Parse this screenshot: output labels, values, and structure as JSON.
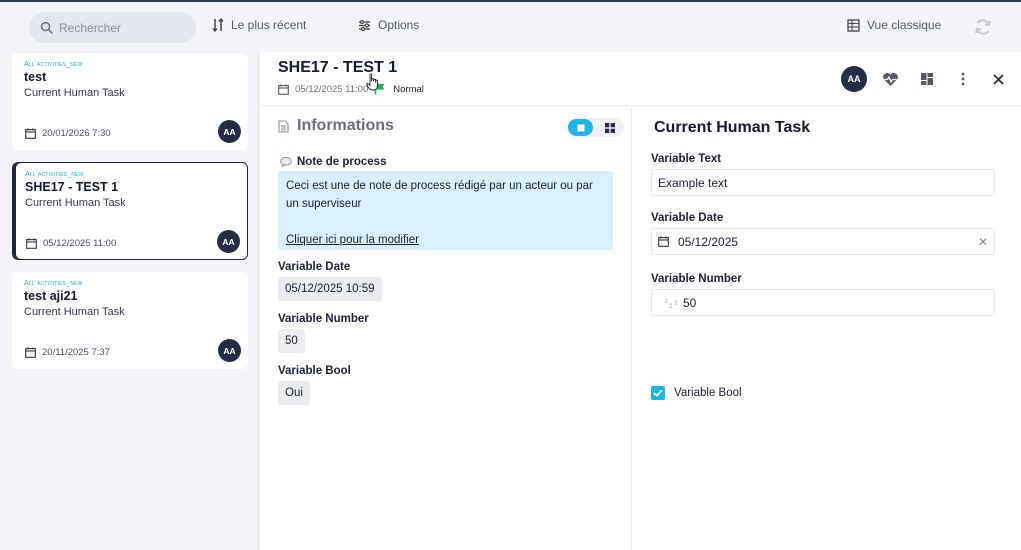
{
  "colors": {
    "accent": "#1fb5e8",
    "dark": "#262b46",
    "flag": "#22b14c",
    "note_bg": "#d7f0fb"
  },
  "toolbar": {
    "search_placeholder": "Rechercher",
    "recent_label": "Le plus récent",
    "options_label": "Options",
    "classic_label": "Vue classique"
  },
  "sidebar": {
    "cards": [
      {
        "category": "All activities_new",
        "title": "test",
        "subtitle": "Current Human Task",
        "date": "20/01/2026 7:30",
        "avatar": "AA",
        "selected": false
      },
      {
        "category": "All activities_new",
        "title": "SHE17 - TEST 1",
        "subtitle": "Current Human Task",
        "date": "05/12/2025 11:00",
        "avatar": "AA",
        "selected": true
      },
      {
        "category": "All activities_new",
        "title": "test aji21",
        "subtitle": "Current Human Task",
        "date": "20/11/2025 7:37",
        "avatar": "AA",
        "selected": false
      }
    ]
  },
  "task": {
    "title": "SHE17 - TEST 1",
    "date": "05/12/2025 11:00",
    "priority": "Normal",
    "avatar": "AA"
  },
  "info": {
    "title": "Informations",
    "note_label": "Note de process",
    "note_text": "Ceci est une de note de process rédigé par un acteur ou par un superviseur",
    "note_link": "Cliquer ici pour la modifier",
    "fields": [
      {
        "label": "Variable Date",
        "value": "05/12/2025 10:59"
      },
      {
        "label": "Variable Number",
        "value": "50"
      },
      {
        "label": "Variable Bool",
        "value": "Oui"
      }
    ]
  },
  "form": {
    "title": "Current Human Task",
    "text_label": "Variable Text",
    "text_value": "Example text",
    "date_label": "Variable Date",
    "date_value": "05/12/2025",
    "number_label": "Variable Number",
    "number_value": "50",
    "bool_label": "Variable Bool",
    "bool_checked": true
  }
}
